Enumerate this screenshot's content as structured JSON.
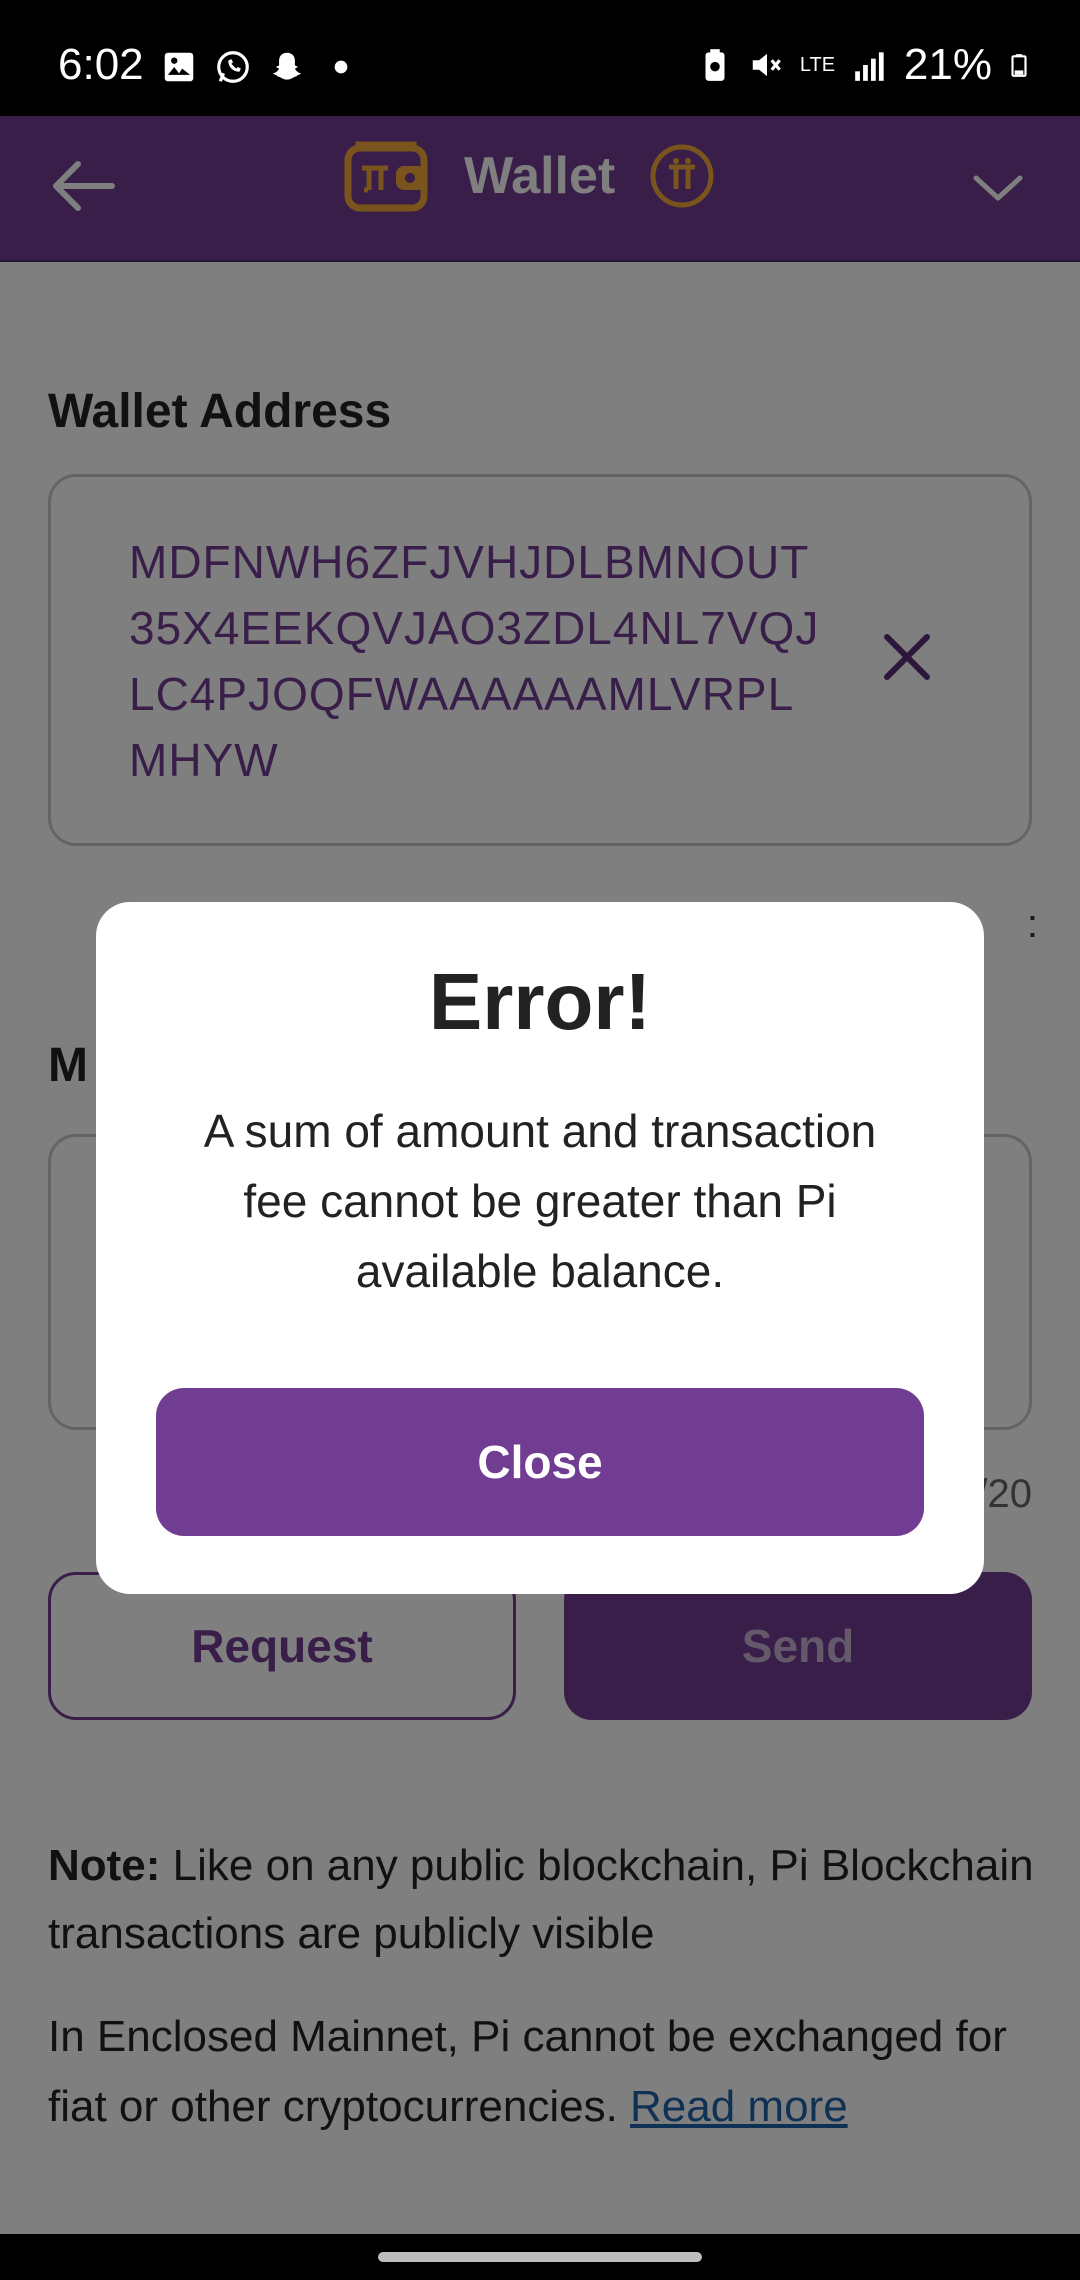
{
  "status_bar": {
    "time": "6:02",
    "battery": "21%",
    "network": "LTE",
    "icons": [
      "gallery-icon",
      "whatsapp-icon",
      "snapchat-icon",
      "dot-icon",
      "battery-saver-icon",
      "mute-icon",
      "lte-icon",
      "signal-icon",
      "battery-icon"
    ]
  },
  "header": {
    "title": "Wallet",
    "back_icon": "arrow-left-icon",
    "dropdown_icon": "chevron-down-icon",
    "accent": "#703d92",
    "logo_color": "#f5a93b"
  },
  "form": {
    "address_label": "Wallet Address",
    "address_value": "MDFNWH6ZFJVHJDLBMNOUT35X4EEKQVJAO3ZDL4NL7VQJLC4PJOQFWAAAAAAMLVRPLMHYW",
    "memo_label_partial": "M",
    "char_count_partial": "/20",
    "truncated_right_text": ":"
  },
  "buttons": {
    "request": "Request",
    "send": "Send"
  },
  "note": {
    "bold": "Note:",
    "text": " Like on any public blockchain, Pi Blockchain transactions are publicly visible"
  },
  "notice": {
    "text": "In Enclosed Mainnet, Pi cannot be exchanged for fiat or other cryptocurrencies. ",
    "link": "Read more"
  },
  "dialog": {
    "title": "Error!",
    "message": "A sum of amount and transaction fee cannot be greater than Pi available balance.",
    "close_label": "Close"
  }
}
